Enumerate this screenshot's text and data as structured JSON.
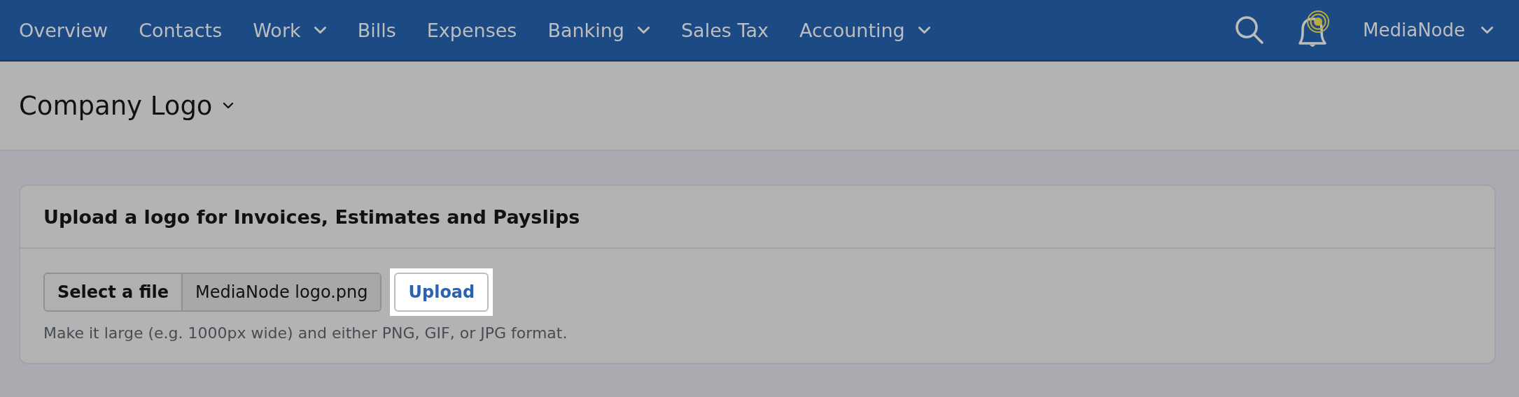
{
  "nav": {
    "items": [
      {
        "label": "Overview",
        "has_menu": false
      },
      {
        "label": "Contacts",
        "has_menu": false
      },
      {
        "label": "Work",
        "has_menu": true
      },
      {
        "label": "Bills",
        "has_menu": false
      },
      {
        "label": "Expenses",
        "has_menu": false
      },
      {
        "label": "Banking",
        "has_menu": true
      },
      {
        "label": "Sales Tax",
        "has_menu": false
      },
      {
        "label": "Accounting",
        "has_menu": true
      }
    ],
    "notifications_unread": true,
    "account": "MediaNode"
  },
  "page": {
    "title": "Company Logo"
  },
  "card": {
    "title": "Upload a logo for Invoices, Estimates and Payslips",
    "select_button": "Select a file",
    "file_name": "MediaNode logo.png",
    "upload_button": {
      "label": "Upload",
      "highlighted": true
    },
    "hint": "Make it large (e.g. 1000px wide) and either PNG, GIF, or JPG format."
  }
}
